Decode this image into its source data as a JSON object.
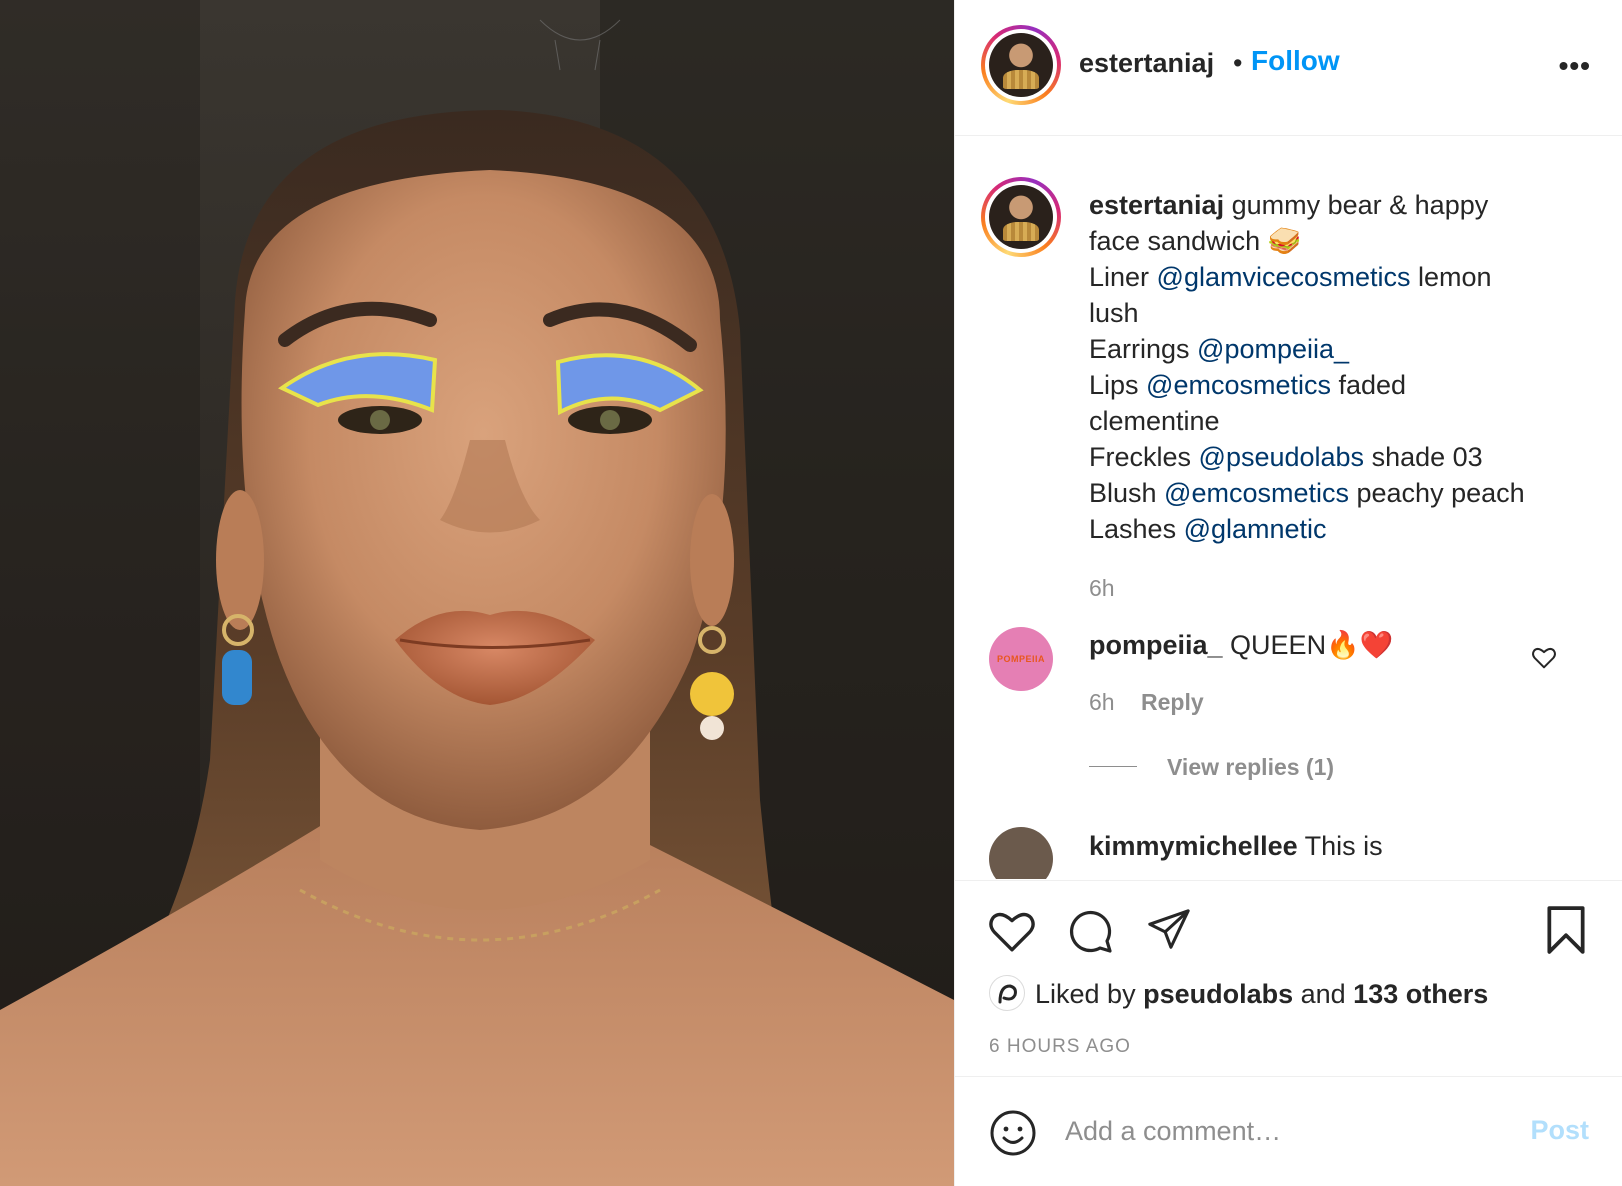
{
  "post": {
    "username": "estertaniaj",
    "separator": "•",
    "follow_label": "Follow",
    "more_icon": "more-options-icon",
    "more_label": "•••"
  },
  "caption": {
    "username": "estertaniaj",
    "line1": "gummy bear & happy",
    "line2": "face sandwich 🥪",
    "liner_prefix": "Liner ",
    "liner_mention": "@glamvicecosmetics",
    "liner_suffix": " lemon",
    "liner_cont": "lush",
    "earrings_prefix": "Earrings ",
    "earrings_mention": "@pompeiia_",
    "lips_prefix": "Lips ",
    "lips_mention": "@emcosmetics",
    "lips_suffix": " faded",
    "lips_cont": "clementine",
    "freckles_prefix": "Freckles ",
    "freckles_mention": "@pseudolabs",
    "freckles_suffix": " shade 03",
    "blush_prefix": "Blush ",
    "blush_mention": "@emcosmetics",
    "blush_suffix": " peachy peach",
    "lashes_prefix": "Lashes ",
    "lashes_mention": "@glamnetic",
    "time": "6h"
  },
  "comments": [
    {
      "username": "pompeiia_",
      "text": " QUEEN🔥❤️",
      "avatar_text": "POMPEIIA",
      "time": "6h",
      "reply_label": "Reply",
      "view_replies": "View replies (1)"
    },
    {
      "username": "kimmymichellee",
      "text": " This is"
    }
  ],
  "actions": {
    "like_icon": "heart-icon",
    "comment_icon": "comment-icon",
    "share_icon": "share-icon",
    "save_icon": "bookmark-icon",
    "liked_prefix": "Liked by ",
    "liked_user": "pseudolabs",
    "liked_middle": " and ",
    "liked_count": "133 others",
    "timestamp": "6 HOURS AGO"
  },
  "comment_box": {
    "emoji_icon": "smiley-icon",
    "placeholder": "Add a comment…",
    "post_label": "Post"
  },
  "colors": {
    "accent": "#0095f6",
    "mention": "#00376b",
    "muted": "#8e8e8e",
    "post_disabled": "#b2dffc"
  }
}
